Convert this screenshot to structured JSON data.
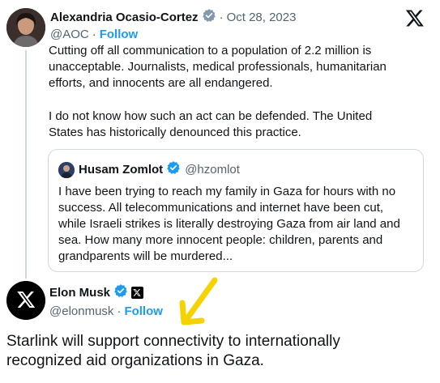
{
  "parent_tweet": {
    "author_name": "Alexandria Ocasio-Cortez",
    "separator": "·",
    "date": "Oct 28, 2023",
    "handle": "@AOC",
    "follow_label": "Follow",
    "paragraph_1": "Cutting off all communication to a population of 2.2 million is unacceptable. Journalists, medical professionals, humanitarian efforts, and innocents are all endangered.",
    "paragraph_2": "I do not know how such an act can be defended. The United States has historically denounced this practice."
  },
  "quoted_tweet": {
    "author_name": "Husam Zomlot",
    "handle": "@hzomlot",
    "text": "I have been trying to reach my family in Gaza for hours with no success. All telecommunications and internet have been cut, while Israeli strikes is literally destroying Gaza from air land and sea. How many more innocent people: children, parents and grandparents will be murdered..."
  },
  "reply_tweet": {
    "author_name": "Elon Musk",
    "handle": "@elonmusk",
    "follow_label": "Follow",
    "text": "Starlink will support connectivity to internationally recognized aid organizations in Gaza."
  },
  "colors": {
    "accent": "#1d9bf0",
    "annotation_arrow": "#f5d300",
    "muted_text": "#536471"
  },
  "icons": [
    "x-logo-icon",
    "verified-badge-icon",
    "affiliate-badge-icon",
    "arrow-annotation"
  ]
}
